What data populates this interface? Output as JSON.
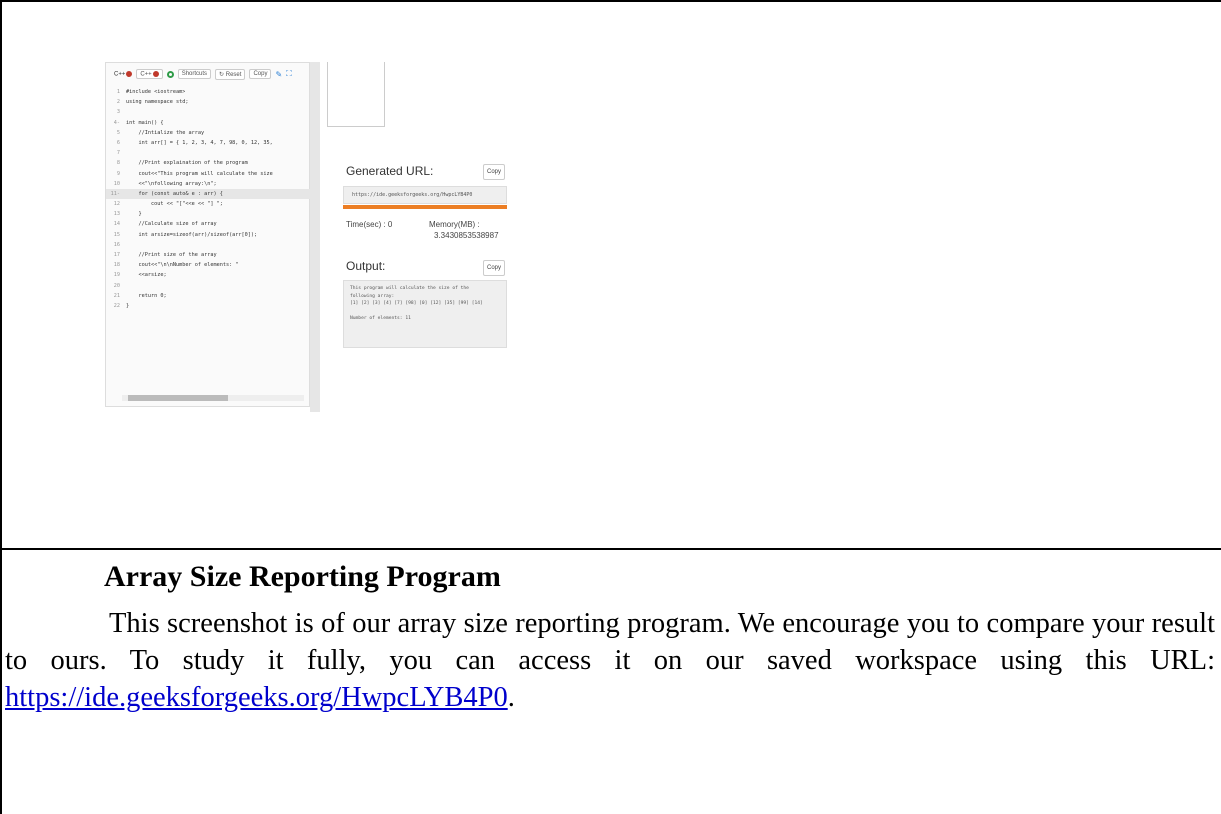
{
  "screenshot": {
    "toolbar": {
      "lang1": "C++",
      "lang2": "C++",
      "shortcuts": "Shortcuts",
      "reset": "Reset",
      "copy": "Copy",
      "reset_icon": "refresh-icon",
      "edit_icon": "pencil-icon",
      "expand_icon": "expand-icon"
    },
    "code_lines": [
      {
        "n": "1",
        "t": "#include <iostream>"
      },
      {
        "n": "2",
        "t": "using namespace std;"
      },
      {
        "n": "3",
        "t": ""
      },
      {
        "n": "4-",
        "t": "int main() {"
      },
      {
        "n": "5",
        "t": "    //Intialize the array"
      },
      {
        "n": "6",
        "t": "    int arr[] = { 1, 2, 3, 4, 7, 98, 0, 12, 35,"
      },
      {
        "n": "7",
        "t": ""
      },
      {
        "n": "8",
        "t": "    //Print explaination of the program"
      },
      {
        "n": "9",
        "t": "    cout<<\"This program will calculate the size"
      },
      {
        "n": "10",
        "t": "    <<\"\\nfollowing array:\\n\";"
      },
      {
        "n": "11-",
        "t": "    for (const auto& e : arr) {"
      },
      {
        "n": "12",
        "t": "        cout << \"[\"<<e << \"] \";"
      },
      {
        "n": "13",
        "t": "    }"
      },
      {
        "n": "14",
        "t": "    //Calculate size of array"
      },
      {
        "n": "15",
        "t": "    int arsize=sizeof(arr)/sizeof(arr[0]);"
      },
      {
        "n": "16",
        "t": ""
      },
      {
        "n": "17",
        "t": "    //Print size of the array"
      },
      {
        "n": "18",
        "t": "    cout<<\"\\n\\nNumber of elements: \""
      },
      {
        "n": "19",
        "t": "    <<arsize;"
      },
      {
        "n": "20",
        "t": ""
      },
      {
        "n": "21",
        "t": "    return 0;"
      },
      {
        "n": "22",
        "t": "}"
      }
    ],
    "generated_url_label": "Generated URL:",
    "generated_url": "https://ide.geeksforgeeks.org/HwpcLYB4P0",
    "copy_label": "Copy",
    "time_label": "Time(sec) : 0",
    "memory_label": "Memory(MB) :",
    "memory_value": "3.3430853538987",
    "output_label": "Output:",
    "output_text": "This program will calculate the size of the\nfollowing array:\n[1] [2] [3] [4] [7] [98] [0] [12] [35] [99] [14]\n\nNumber of elements: 11",
    "accent_color": "#ec7e24"
  },
  "caption": {
    "title": "Array Size Reporting Program",
    "body_text": "This screenshot is of our array size reporting program. We encourage you to compare your result to ours. To study it fully, you can access it on our saved workspace using this URL: ",
    "link_text": "https://ide.geeksforgeeks.org/HwpcLYB4P0",
    "trailing": "."
  }
}
